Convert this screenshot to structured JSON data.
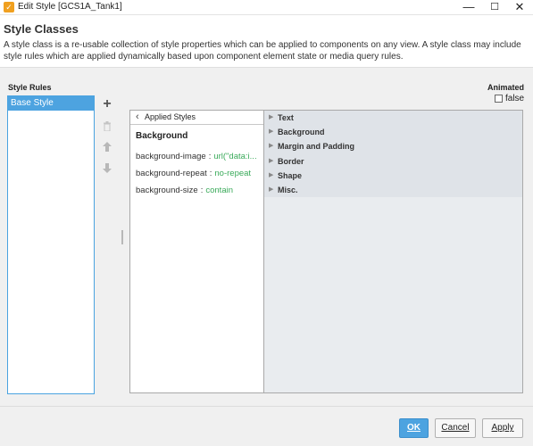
{
  "window": {
    "title": "Edit Style [GCS1A_Tank1]",
    "app_icon": "ignition-icon",
    "controls": {
      "minimize": "—",
      "maximize": "☐",
      "close": "✕"
    }
  },
  "header": {
    "title": "Style Classes",
    "description": "A style class is a re-usable collection of style properties which can be applied to components on any view. A style class may include style rules which are applied dynamically based upon component element state or media query rules."
  },
  "style_rules": {
    "label": "Style Rules",
    "items": [
      {
        "label": "Base Style",
        "selected": true
      }
    ],
    "buttons": {
      "add": "+",
      "delete": "🗑",
      "up": "↑",
      "down": "↓"
    }
  },
  "animated": {
    "label": "Animated",
    "checked": false,
    "value": "false"
  },
  "applied_styles": {
    "header": "Applied Styles",
    "back_icon": "‹",
    "group": "Background",
    "properties": [
      {
        "key": "background-image",
        "value": "url(\"data:i..."
      },
      {
        "key": "background-repeat",
        "value": "no-repeat"
      },
      {
        "key": "background-size",
        "value": "contain"
      }
    ]
  },
  "categories": [
    {
      "label": "Text"
    },
    {
      "label": "Background"
    },
    {
      "label": "Margin and Padding"
    },
    {
      "label": "Border"
    },
    {
      "label": "Shape"
    },
    {
      "label": "Misc."
    }
  ],
  "footer": {
    "ok": "OK",
    "cancel": "Cancel",
    "apply": "Apply"
  },
  "colors": {
    "accent": "#4da3e0",
    "value_green": "#3aaa5a",
    "category_bg": "#dfe3e8"
  }
}
